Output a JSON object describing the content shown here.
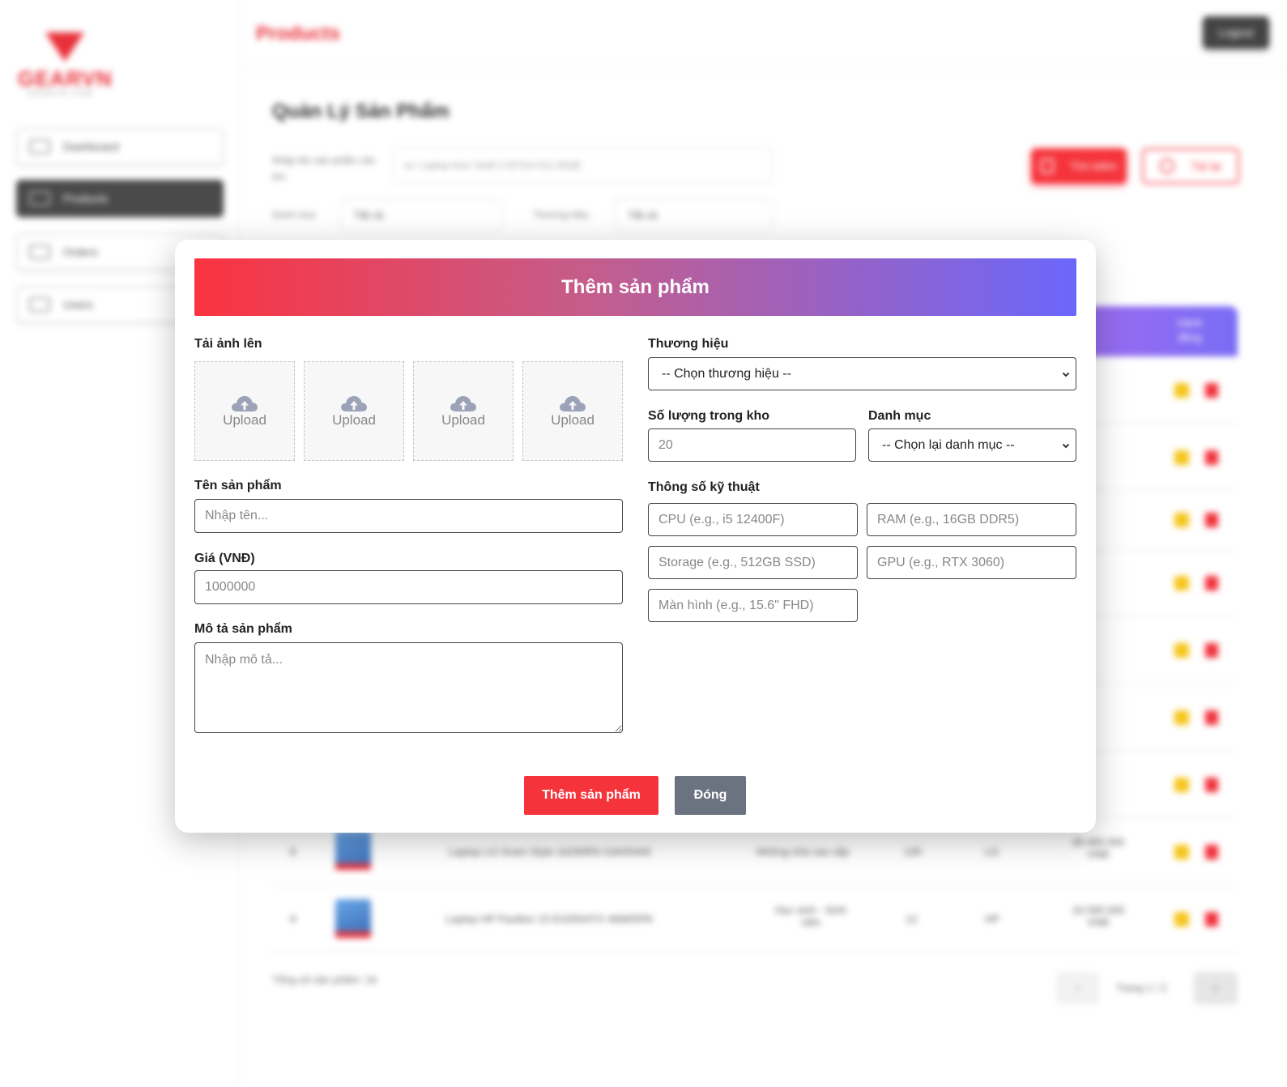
{
  "app": {
    "logo_text": "GEARVN",
    "logo_sub": "GEARVN.COM",
    "nav": [
      {
        "label": "Dashboard"
      },
      {
        "label": "Products"
      },
      {
        "label": "Orders"
      },
      {
        "label": "Users"
      }
    ],
    "topbar_title": "Products",
    "logout_label": "Logout",
    "page_heading": "Quản Lý Sản Phẩm",
    "filters": {
      "search_label": "Nhập tên sản phẩm cần tìm",
      "search_placeholder": "ex: Laptop Acer Swift 3 SF314-511-55QE",
      "category_label": "Danh mục",
      "category_value": "Tất cả",
      "brand_label": "Thương hiệu",
      "brand_value": "Tất cả",
      "search_button": "Tìm kiếm",
      "reset_button": "Tải lại"
    },
    "table": {
      "action_header": "Hành động",
      "rows": [
        {
          "index": "8",
          "name": "Laptop LG Gram Style 16Z90RS GAH54A5",
          "category": "Những nhà cao cấp",
          "stock": "135",
          "brand": "LG",
          "price": "28.490.000 VNĐ"
        },
        {
          "index": "9",
          "name": "Laptop HP Pavilion 15 EG0504TX 46M05PA",
          "category": "Học sinh - Sinh viên",
          "stock": "12",
          "brand": "HP",
          "price": "16.590.000 VNĐ"
        }
      ]
    },
    "total_text": "Tổng số sản phẩm: 16",
    "pager_text": "Trang 1 / 2"
  },
  "modal": {
    "title": "Thêm sản phẩm",
    "upload_label": "Tải ảnh lên",
    "upload_slots": [
      "Upload",
      "Upload",
      "Upload",
      "Upload"
    ],
    "name_label": "Tên sản phẩm",
    "name_placeholder": "Nhập tên...",
    "price_label": "Giá (VNĐ)",
    "price_value": "1000000",
    "desc_label": "Mô tả sản phẩm",
    "desc_placeholder": "Nhập mô tả...",
    "brand_label": "Thương hiệu",
    "brand_selected": "-- Chọn thương hiệu --",
    "stock_label": "Số lượng trong kho",
    "stock_value": "20",
    "category_label": "Danh mục",
    "category_selected": "-- Chọn lại danh mục --",
    "specs_label": "Thông số kỹ thuật",
    "cpu_placeholder": "CPU (e.g., i5 12400F)",
    "ram_placeholder": "RAM (e.g., 16GB DDR5)",
    "storage_placeholder": "Storage (e.g., 512GB SSD)",
    "gpu_placeholder": "GPU (e.g., RTX 3060)",
    "screen_placeholder": "Màn hình (e.g., 15.6\" FHD)",
    "submit_label": "Thêm sản phẩm",
    "close_label": "Đóng"
  }
}
